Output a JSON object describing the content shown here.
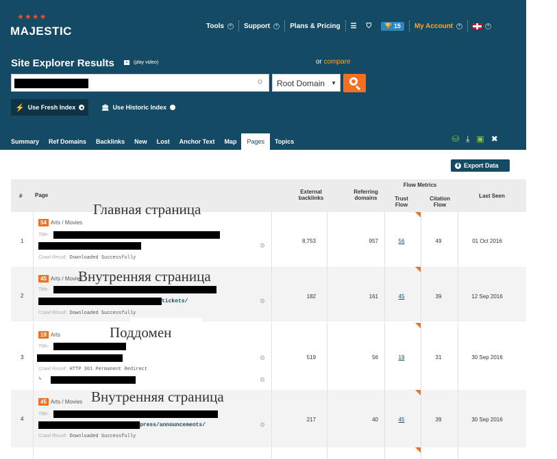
{
  "logo": {
    "word": "MAJESTIC",
    "stars": "★★★★"
  },
  "topnav": {
    "tools": "Tools",
    "support": "Support",
    "plans": "Plans & Pricing",
    "trophy_count": "15",
    "my_account": "My Account"
  },
  "header": {
    "title": "Site Explorer Results",
    "play_video": "(play video)",
    "or_text": "or",
    "compare": "compare"
  },
  "search": {
    "scope": "Root Domain"
  },
  "index": {
    "fresh": "Use Fresh Index",
    "historic": "Use Historic Index"
  },
  "tabs": [
    "Summary",
    "Ref Domains",
    "Backlinks",
    "New",
    "Lost",
    "Anchor Text",
    "Map",
    "Pages",
    "Topics"
  ],
  "active_tab": "Pages",
  "export": "Export Data",
  "table": {
    "headers": {
      "num": "#",
      "page": "Page",
      "ext1": "External",
      "ext2": "backlinks",
      "ref1": "Referring",
      "ref2": "domains",
      "flow": "Flow Metrics",
      "tf1": "Trust",
      "tf2": "Flow",
      "cf1": "Citation",
      "cf2": "Flow",
      "last": "Last Seen"
    },
    "title_label": "Title:",
    "crawl_label": "Crawl Result:",
    "rows": [
      {
        "num": "1",
        "tf_badge": "54",
        "category": "Arts / Movies",
        "url_suffix": "",
        "crawl": "Downloaded Successfully",
        "ext": "8,753",
        "ref": "957",
        "tf": "56",
        "cf": "49",
        "last": "01 Oct 2016"
      },
      {
        "num": "2",
        "tf_badge": "45",
        "category": "Arts / Movies",
        "url_suffix": "tickets/",
        "crawl": "Downloaded Successfully",
        "ext": "182",
        "ref": "161",
        "tf": "45",
        "cf": "39",
        "last": "12 Sep 2016"
      },
      {
        "num": "3",
        "tf_badge": "19",
        "category": "Arts",
        "url_suffix": "",
        "crawl": "HTTP 301 Permanent Redirect",
        "ext": "519",
        "ref": "56",
        "tf": "19",
        "cf": "31",
        "last": "30 Sep 2016"
      },
      {
        "num": "4",
        "tf_badge": "45",
        "category": "Arts / Movies",
        "url_suffix": "press/announcements/",
        "crawl": "Downloaded Successfully",
        "ext": "217",
        "ref": "40",
        "tf": "45",
        "cf": "39",
        "last": "30 Sep 2016"
      }
    ]
  },
  "annotations": [
    "Главная страница",
    "Внутренняя страница",
    "Поддомен",
    "Внутренняя страница"
  ]
}
